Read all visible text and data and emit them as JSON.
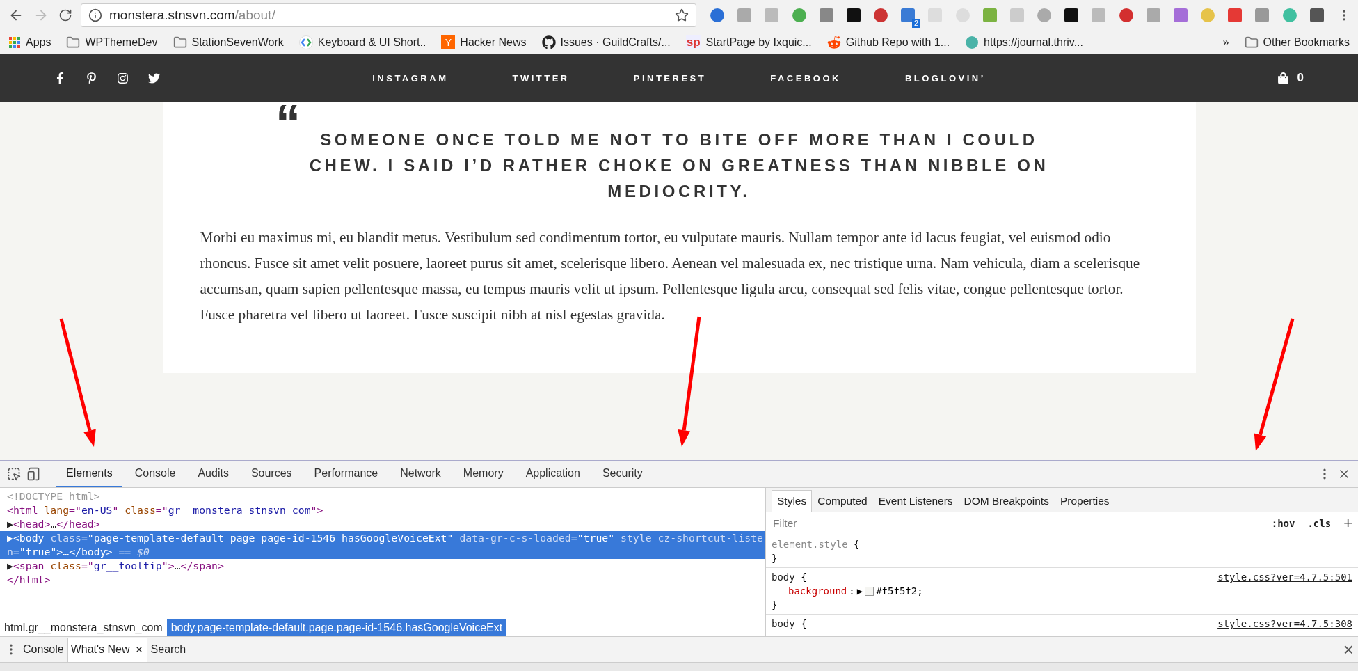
{
  "browser": {
    "url": {
      "host": "monstera.stnsvn.com",
      "path": "/about/"
    },
    "extension_badge": "2",
    "bookmarks": [
      {
        "kind": "apps",
        "label": "Apps"
      },
      {
        "kind": "folder",
        "label": "WPThemeDev"
      },
      {
        "kind": "folder",
        "label": "StationSevenWork"
      },
      {
        "kind": "google",
        "label": "Keyboard & UI Short.."
      },
      {
        "kind": "hn",
        "label": "Hacker News",
        "icon_text": "Y"
      },
      {
        "kind": "github",
        "label": "Issues · GuildCrafts/..."
      },
      {
        "kind": "sp",
        "label": "StartPage by Ixquic...",
        "icon_text": "sp"
      },
      {
        "kind": "reddit",
        "label": "Github Repo with 1..."
      },
      {
        "kind": "leaf",
        "label": "https://journal.thriv..."
      }
    ],
    "overflow": "»",
    "other_bookmarks": "Other Bookmarks"
  },
  "site": {
    "nav_links": [
      "INSTAGRAM",
      "TWITTER",
      "PINTEREST",
      "FACEBOOK",
      "BLOGLOVIN’"
    ],
    "cart_count": "0",
    "quote_mark": "“",
    "quote": "SOMEONE ONCE TOLD ME NOT TO BITE OFF MORE THAN I COULD CHEW. I SAID I’D RATHER CHOKE ON GREATNESS THAN NIBBLE ON MEDIOCRITY.",
    "paragraph": "Morbi eu maximus mi, eu blandit metus. Vestibulum sed condimentum tortor, eu vulputate mauris. Nullam tempor ante id lacus feugiat, vel euismod odio rhoncus. Fusce sit amet velit posuere, laoreet purus sit amet, scelerisque libero. Aenean vel malesuada ex, nec tristique urna. Nam vehicula, diam a scelerisque accumsan, quam sapien pellentesque massa, eu tempus mauris velit ut ipsum. Pellentesque ligula arcu, consequat sed felis vitae, congue pellentesque tortor. Fusce pharetra vel libero ut laoreet. Fusce suscipit nibh at nisl egestas gravida."
  },
  "devtools": {
    "tabs": [
      {
        "label": "Elements",
        "selected": true
      },
      {
        "label": "Console",
        "selected": false
      },
      {
        "label": "Audits",
        "selected": false
      },
      {
        "label": "Sources",
        "selected": false
      },
      {
        "label": "Performance",
        "selected": false
      },
      {
        "label": "Network",
        "selected": false
      },
      {
        "label": "Memory",
        "selected": false
      },
      {
        "label": "Application",
        "selected": false
      },
      {
        "label": "Security",
        "selected": false
      }
    ],
    "dom_lines": [
      {
        "selected": false,
        "tokens": [
          {
            "kind": "comment",
            "text": "<!DOCTYPE html>"
          }
        ]
      },
      {
        "selected": false,
        "tokens": [
          {
            "kind": "tag",
            "text": "<html "
          },
          {
            "kind": "attr",
            "text": "lang"
          },
          {
            "kind": "tag",
            "text": "=\""
          },
          {
            "kind": "val",
            "text": "en-US"
          },
          {
            "kind": "tag",
            "text": "\" "
          },
          {
            "kind": "attr",
            "text": "class"
          },
          {
            "kind": "tag",
            "text": "=\""
          },
          {
            "kind": "val",
            "text": "gr__monstera_stnsvn_com"
          },
          {
            "kind": "tag",
            "text": "\">"
          }
        ]
      },
      {
        "selected": false,
        "toggle": "▶",
        "tokens": [
          {
            "kind": "tag",
            "text": "<head>"
          },
          {
            "kind": "plain",
            "text": "…"
          },
          {
            "kind": "tag",
            "text": "</head>"
          }
        ]
      },
      {
        "selected": true,
        "toggle": "▶",
        "tokens": [
          {
            "kind": "tag",
            "text": "<body "
          },
          {
            "kind": "attr",
            "text": "class"
          },
          {
            "kind": "tag",
            "text": "=\""
          },
          {
            "kind": "val",
            "text": "page-template-default page page-id-1546 hasGoogleVoiceExt"
          },
          {
            "kind": "tag",
            "text": "\" "
          },
          {
            "kind": "attr",
            "text": "data-gr-c-s-loaded"
          },
          {
            "kind": "tag",
            "text": "=\""
          },
          {
            "kind": "val",
            "text": "true"
          },
          {
            "kind": "tag",
            "text": "\" "
          },
          {
            "kind": "attr",
            "text": "style cz-shortcut-listen"
          },
          {
            "kind": "tag",
            "text": "=\""
          },
          {
            "kind": "val",
            "text": "true"
          },
          {
            "kind": "tag",
            "text": "\">"
          },
          {
            "kind": "plain",
            "text": "…"
          },
          {
            "kind": "tag",
            "text": "</body>"
          },
          {
            "kind": "plain",
            "text": " == "
          },
          {
            "kind": "ref",
            "text": "$0"
          }
        ]
      },
      {
        "selected": false,
        "toggle": "▶",
        "tokens": [
          {
            "kind": "tag",
            "text": "<span "
          },
          {
            "kind": "attr",
            "text": "class"
          },
          {
            "kind": "tag",
            "text": "=\""
          },
          {
            "kind": "val",
            "text": "gr__tooltip"
          },
          {
            "kind": "tag",
            "text": "\">"
          },
          {
            "kind": "plain",
            "text": "…"
          },
          {
            "kind": "tag",
            "text": "</span>"
          }
        ]
      },
      {
        "selected": false,
        "tokens": [
          {
            "kind": "tag",
            "text": "</html>"
          }
        ]
      }
    ],
    "breadcrumbs": [
      {
        "label": "html.gr__monstera_stnsvn_com",
        "selected": false
      },
      {
        "label": "body.page-template-default.page.page-id-1546.hasGoogleVoiceExt",
        "selected": true
      }
    ],
    "side_tabs": [
      {
        "label": "Styles",
        "selected": true
      },
      {
        "label": "Computed",
        "selected": false
      },
      {
        "label": "Event Listeners",
        "selected": false
      },
      {
        "label": "DOM Breakpoints",
        "selected": false
      },
      {
        "label": "Properties",
        "selected": false
      }
    ],
    "filter": {
      "placeholder": "Filter"
    },
    "hov": ":hov",
    "cls": ".cls",
    "add": "+",
    "rules": [
      {
        "selector": "element.style",
        "muted": true,
        "open": "{",
        "close": "}"
      },
      {
        "selector": "body",
        "muted": false,
        "open": "{",
        "close": "}",
        "source": "style.css?ver=4.7.5:501",
        "props": [
          {
            "name": "background",
            "colon": ":",
            "arrow": "▶",
            "value": "#f5f5f2",
            "end": ";"
          }
        ]
      },
      {
        "selector": "body",
        "muted": false,
        "open": "{",
        "source": "style.css?ver=4.7.5:308"
      }
    ],
    "drawer_tabs": [
      {
        "label": "Console",
        "selected": false,
        "closable": false
      },
      {
        "label": "What's New",
        "selected": true,
        "closable": true
      },
      {
        "label": "Search",
        "selected": false,
        "closable": false
      }
    ],
    "close_glyph": "×"
  }
}
